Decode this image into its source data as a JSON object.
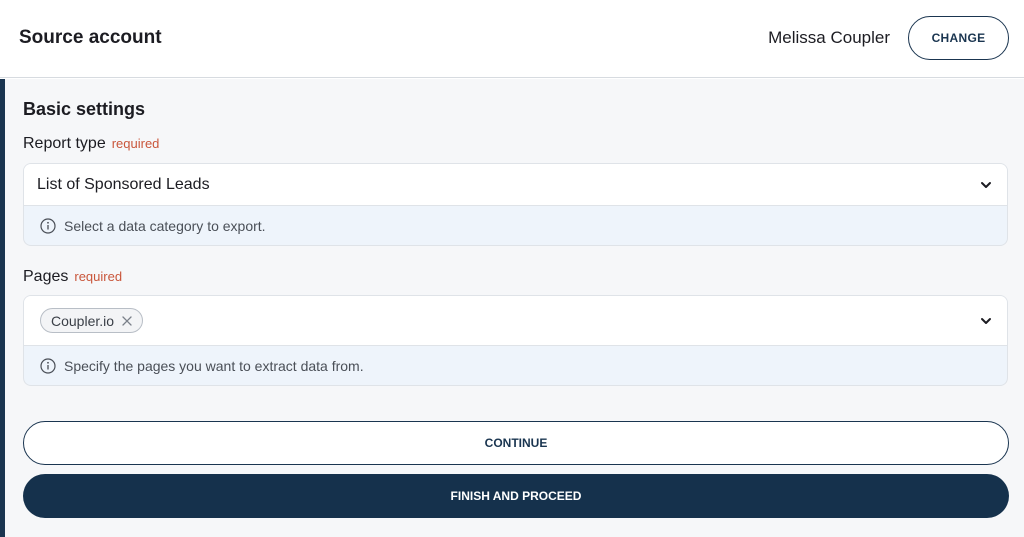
{
  "header": {
    "title": "Source account",
    "account_name": "Melissa Coupler",
    "change_label": "CHANGE"
  },
  "basic_settings": {
    "title": "Basic settings",
    "report_type": {
      "label": "Report type",
      "required_label": "required",
      "value": "List of Sponsored Leads",
      "hint": "Select a data category to export."
    },
    "pages": {
      "label": "Pages",
      "required_label": "required",
      "chips": [
        "Coupler.io"
      ],
      "hint": "Specify the pages you want to extract data from."
    }
  },
  "actions": {
    "continue_label": "CONTINUE",
    "finish_label": "FINISH AND PROCEED"
  },
  "colors": {
    "primary": "#15314c",
    "required": "#c9563b",
    "panel_bg": "#f6f7f9",
    "hint_bg": "#eef4fb"
  },
  "icons": [
    "chevron-down-icon",
    "info-icon",
    "close-icon"
  ]
}
